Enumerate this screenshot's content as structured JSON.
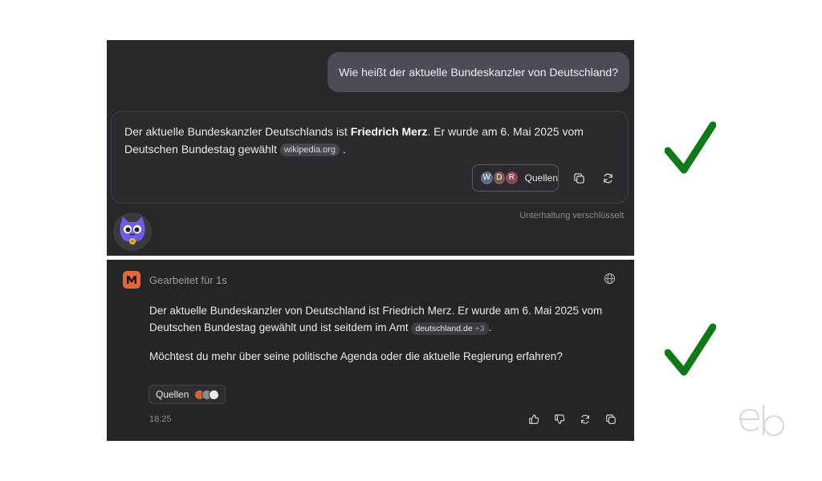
{
  "panel1": {
    "user_question": "Wie heißt der aktuelle Bundeskanzler von Deutschland?",
    "answer": {
      "part1": "Der aktuelle Bundeskanzler Deutschlands ist ",
      "bold_name": "Friedrich Merz",
      "part2": ". Er wurde am 6. Mai 2025 vom Deutschen Bundestag gewählt ",
      "source_pill": "wikipedia.org",
      "end": "."
    },
    "sources": {
      "avatars": [
        {
          "letter": "W",
          "color": "#5a6f84"
        },
        {
          "letter": "D",
          "color": "#7a5a4e"
        },
        {
          "letter": "R",
          "color": "#8a4a55"
        }
      ],
      "label": "Quellen"
    },
    "icons": [
      "copy-icon",
      "regenerate-icon"
    ],
    "encrypted_note": "Unterhaltung verschlüsselt",
    "mascot": "cat-mascot-avatar"
  },
  "panel2": {
    "worked_label": "Gearbeitet für 1s",
    "paragraph1": {
      "text": "Der aktuelle Bundeskanzler von Deutschland ist Friedrich Merz. Er wurde am 6. Mai 2025 vom Deutschen Bundestag gewählt und ist seitdem im Amt ",
      "pill": "deutschland.de",
      "pill_extra": "+3",
      "end": "."
    },
    "paragraph2": "Möchtest du mehr über seine politische Agenda oder die aktuelle Regierung erfahren?",
    "sources_label": "Quellen",
    "source_icon_colors": [
      "#d9613a",
      "#8a8a8a",
      "#e8e8e8"
    ],
    "time": "18:25",
    "actions": [
      "thumbs-up-icon",
      "thumbs-down-icon",
      "regenerate-icon",
      "copy-icon"
    ]
  },
  "colors": {
    "check": "#0e7a17",
    "logo": "#e0683a",
    "panel_bg": "#262528"
  }
}
